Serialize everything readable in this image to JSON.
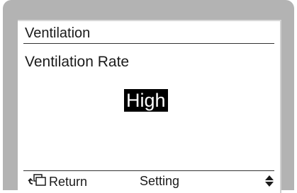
{
  "screen": {
    "title": "Ventilation",
    "label": "Ventilation Rate",
    "value": "High"
  },
  "footer": {
    "return_label": "Return",
    "setting_label": "Setting"
  },
  "icons": {
    "return": "return-icon",
    "updown": "up-down-arrows-icon"
  }
}
